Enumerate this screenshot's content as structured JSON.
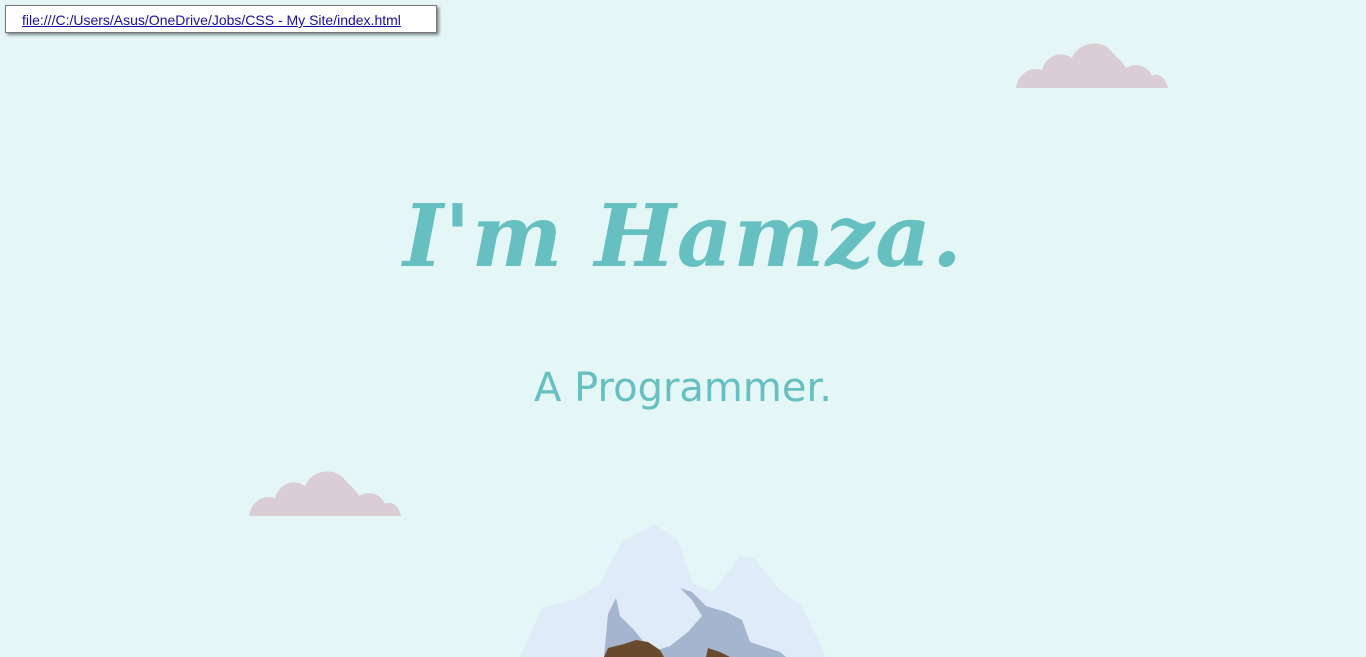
{
  "status_link": {
    "url": "file:///C:/Users/Asus/OneDrive/Jobs/CSS - My Site/index.html"
  },
  "hero": {
    "title": "I'm Hamza.",
    "subtitle": "A Programmer."
  },
  "colors": {
    "background": "#e4f6f6",
    "accent": "#66c0c2",
    "cloud": "#dacdd3",
    "mountain_snow": "#dfebf8",
    "mountain_rock": "#a3b5cf",
    "mountain_earth": "#6a4a2c"
  },
  "decor": {
    "top_cloud_icon": "cloud-icon",
    "left_cloud_icon": "cloud-icon",
    "mountain_icon": "mountain-illustration"
  }
}
